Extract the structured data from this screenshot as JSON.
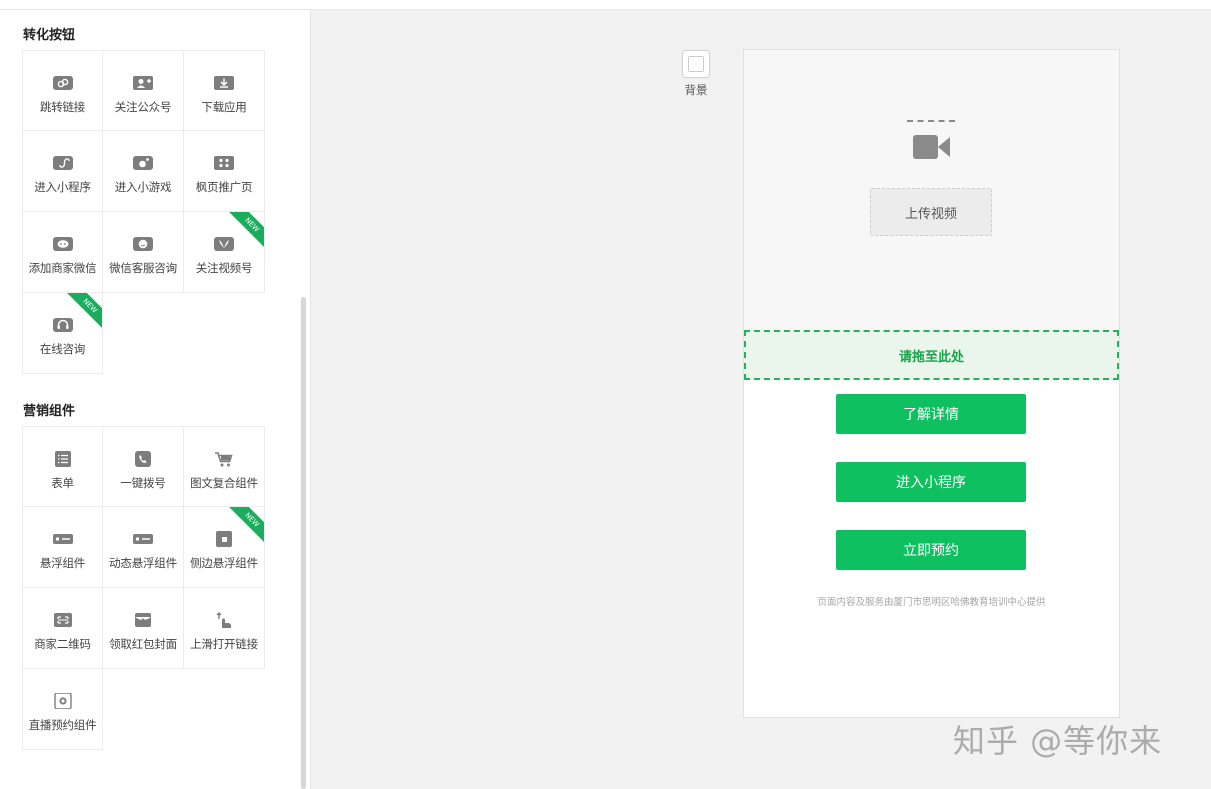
{
  "sidebar": {
    "sections": [
      {
        "title": "转化按钮",
        "items": [
          {
            "label": "跳转链接",
            "icon": "link-icon",
            "isNew": false
          },
          {
            "label": "关注公众号",
            "icon": "add-user-icon",
            "isNew": false
          },
          {
            "label": "下载应用",
            "icon": "download-icon",
            "isNew": false
          },
          {
            "label": "进入小程序",
            "icon": "mini-program-icon",
            "isNew": false
          },
          {
            "label": "进入小游戏",
            "icon": "mini-game-icon",
            "isNew": false
          },
          {
            "label": "枫页推广页",
            "icon": "grid-icon",
            "isNew": false
          },
          {
            "label": "添加商家微信",
            "icon": "chat-bubble-icon",
            "isNew": false
          },
          {
            "label": "微信客服咨询",
            "icon": "wechat-service-icon",
            "isNew": false
          },
          {
            "label": "关注视频号",
            "icon": "channels-icon",
            "isNew": true
          },
          {
            "label": "在线咨询",
            "icon": "headset-icon",
            "isNew": true
          }
        ]
      },
      {
        "title": "营销组件",
        "items": [
          {
            "label": "表单",
            "icon": "form-list-icon",
            "isNew": false
          },
          {
            "label": "一键拨号",
            "icon": "phone-icon",
            "isNew": false
          },
          {
            "label": "图文复合组件",
            "icon": "cart-icon",
            "isNew": false
          },
          {
            "label": "悬浮组件",
            "icon": "floating-bar-icon",
            "isNew": false
          },
          {
            "label": "动态悬浮组件",
            "icon": "dynamic-floating-bar-icon",
            "isNew": false
          },
          {
            "label": "侧边悬浮组件",
            "icon": "side-floating-icon",
            "isNew": true
          },
          {
            "label": "商家二维码",
            "icon": "qr-code-icon",
            "isNew": false
          },
          {
            "label": "领取红包封面",
            "icon": "red-envelope-icon",
            "isNew": false
          },
          {
            "label": "上滑打开链接",
            "icon": "swipe-up-icon",
            "isNew": false
          },
          {
            "label": "直播预约组件",
            "icon": "live-reservation-icon",
            "isNew": false
          }
        ]
      }
    ],
    "new_badge": "NEW"
  },
  "canvas": {
    "background_label": "背景",
    "upload_video_label": "上传视频",
    "drop_hint": "请拖至此处",
    "buttons": [
      "了解详情",
      "进入小程序",
      "立即预约"
    ],
    "footer_note": "页面内容及服务由厦门市思明区哈佛教育培训中心提供"
  },
  "watermark": "知乎 @等你来",
  "colors": {
    "accent_green": "#0ec060",
    "drop_zone_border": "#22b35c",
    "new_ribbon": "#1aad5e",
    "icon_gray": "#7d7d7d"
  }
}
